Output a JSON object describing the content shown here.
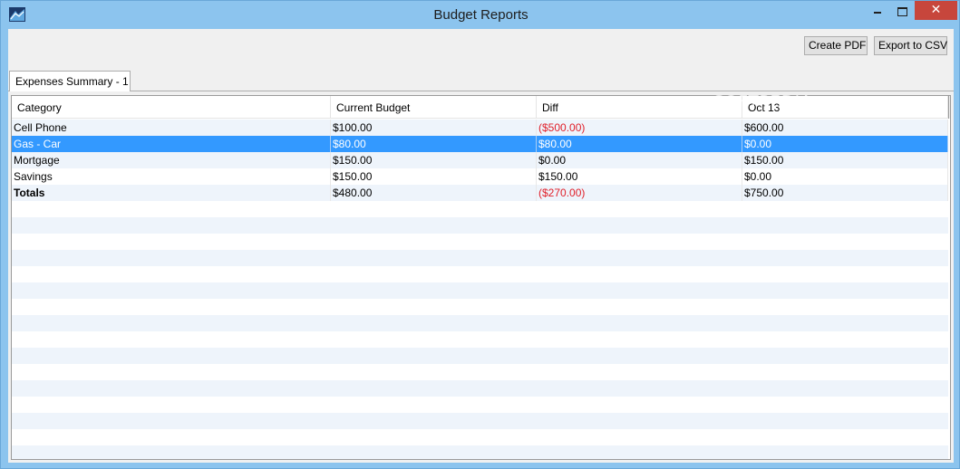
{
  "window": {
    "title": "Budget Reports",
    "close_glyph": "✕"
  },
  "toolbar": {
    "create_pdf_label": "Create PDF",
    "export_csv_label": "Export to CSV"
  },
  "tabs": [
    {
      "label": "Expenses Summary - 1",
      "selected": true
    }
  ],
  "table": {
    "columns": [
      "Category",
      "Current Budget",
      "Diff",
      "Oct 13"
    ],
    "rows": [
      {
        "category": "Cell Phone",
        "current_budget": "$100.00",
        "diff": "($500.00)",
        "oct13": "$600.00"
      },
      {
        "category": "Gas - Car",
        "current_budget": "$80.00",
        "diff": "$80.00",
        "oct13": "$0.00",
        "selected": true
      },
      {
        "category": "Mortgage",
        "current_budget": "$150.00",
        "diff": "$0.00",
        "oct13": "$150.00"
      },
      {
        "category": "Savings",
        "current_budget": "$150.00",
        "diff": "$150.00",
        "oct13": "$0.00"
      },
      {
        "category": "Totals",
        "current_budget": "$480.00",
        "diff": "($270.00)",
        "oct13": "$750.00"
      }
    ]
  },
  "colors": {
    "selection": "#3399ff",
    "negative": "#e0202a",
    "alt_row": "#eef4fb",
    "window_frame": "#8cc4ee",
    "close_button": "#c7463c"
  },
  "watermark": "SOFTPEDIA"
}
